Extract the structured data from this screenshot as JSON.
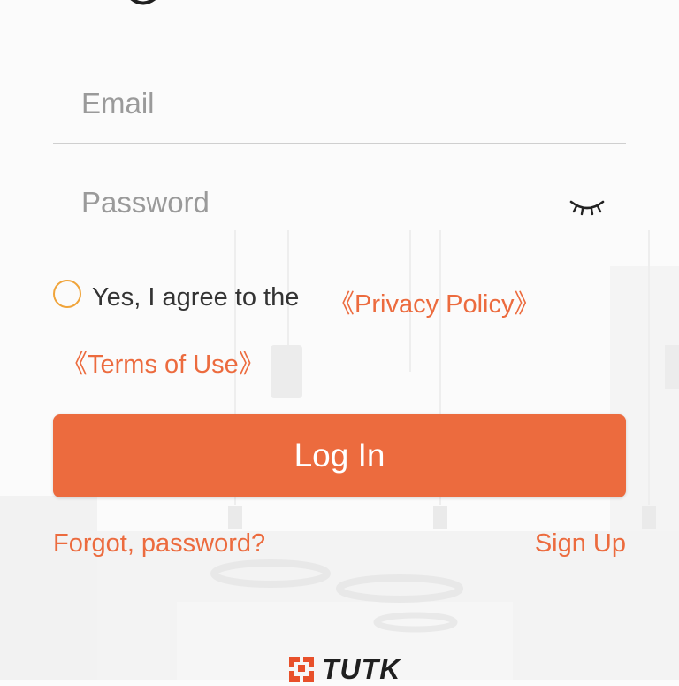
{
  "form": {
    "email": {
      "placeholder": "Email",
      "value": ""
    },
    "password": {
      "placeholder": "Password",
      "value": ""
    }
  },
  "agreement": {
    "text": "Yes, I agree to the",
    "privacy_link": "《Privacy Policy》",
    "terms_link": "《Terms of Use》",
    "checked": false
  },
  "actions": {
    "login_label": "Log In",
    "forgot_label": "Forgot, password?",
    "signup_label": "Sign Up"
  },
  "brand": {
    "name": "TUTK",
    "logo_icon": "tutk-logo-mark"
  },
  "icons": {
    "password_toggle": "eye-closed-icon",
    "top_logo": "app-logo-arc"
  },
  "colors": {
    "accent": "#ec6b3e",
    "radio_border": "#f0a43a",
    "text": "#333333",
    "placeholder": "#9a9a9a",
    "divider": "#cfcfcf"
  }
}
